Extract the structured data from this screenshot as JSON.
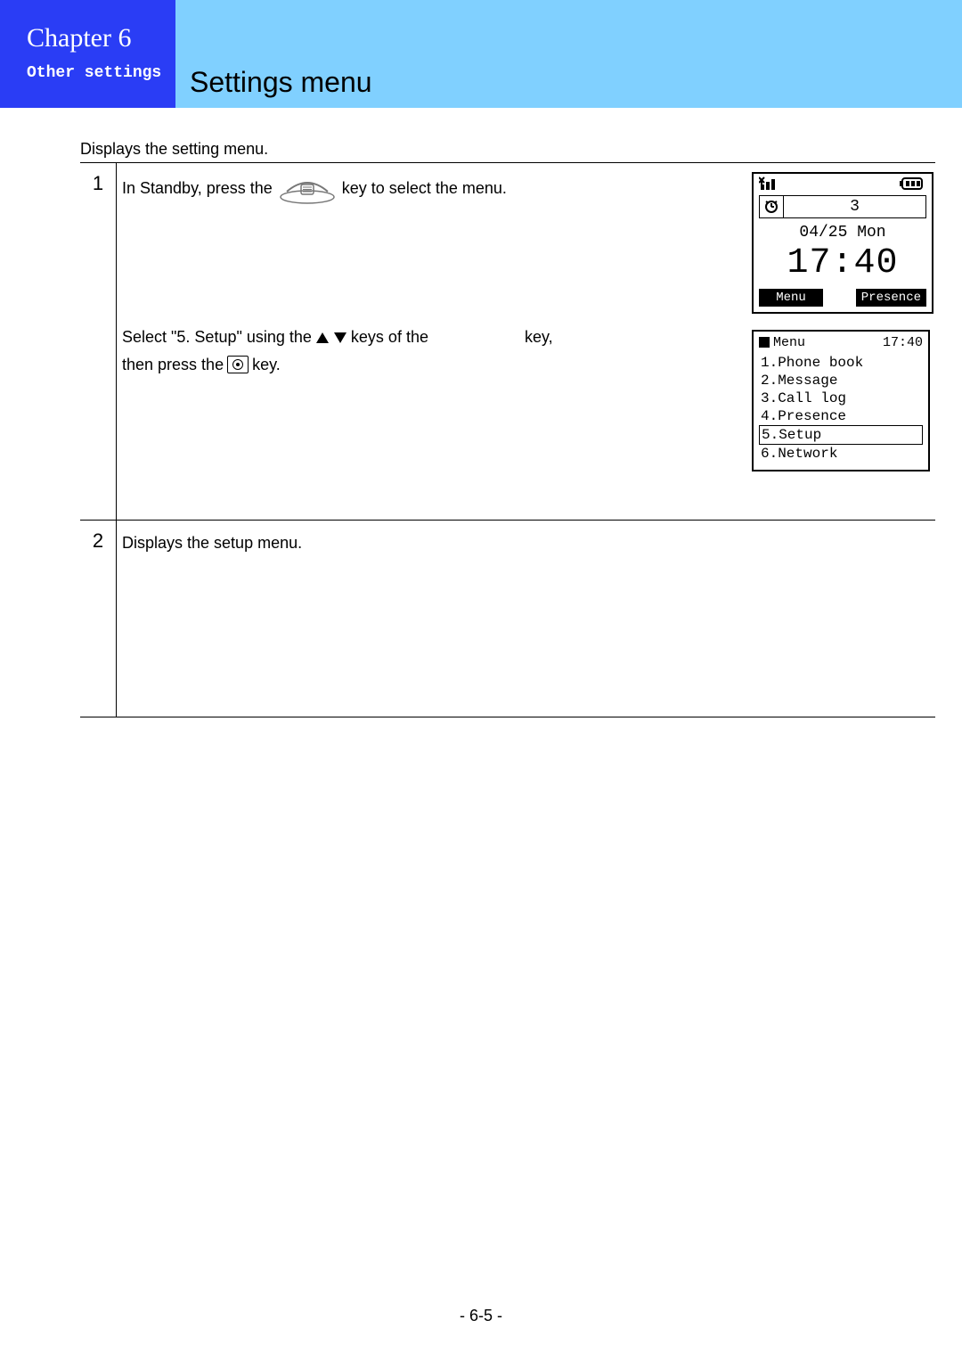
{
  "header": {
    "chapter": "Chapter 6",
    "subtitle": "Other settings",
    "title": "Settings menu"
  },
  "intro": "Displays the setting menu.",
  "steps": [
    {
      "num": "1",
      "line1_a": "In Standby, press the",
      "line1_b": "key to select the menu.",
      "line2_a": "Select \"5. Setup\" using the",
      "line2_b": "keys of the",
      "line2_c": "key,",
      "line3_a": "then press the",
      "line3_b": "key."
    },
    {
      "num": "2",
      "text": "Displays the setup menu."
    }
  ],
  "standby": {
    "count": "3",
    "date": "04/25 Mon",
    "time": "17:40",
    "softkeys": [
      "Menu",
      "Presence"
    ]
  },
  "menu": {
    "title": "Menu",
    "time": "17:40",
    "items": [
      "1.Phone book",
      "2.Message",
      "3.Call log",
      "4.Presence",
      "5.Setup",
      "6.Network"
    ],
    "selected_index": 4
  },
  "footer": "- 6-5 -"
}
